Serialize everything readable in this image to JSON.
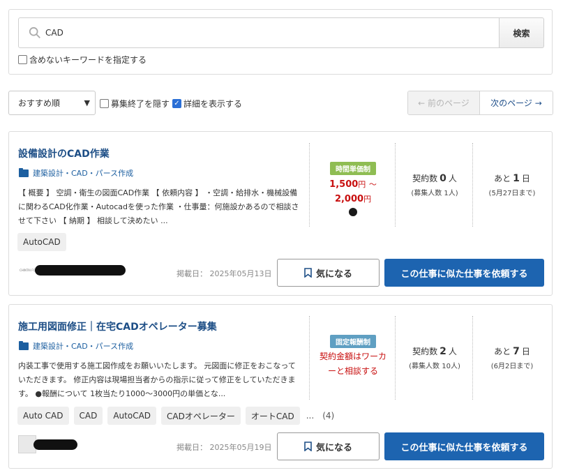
{
  "search": {
    "query": "CAD",
    "button_label": "検索",
    "exclude_label": "含めないキーワードを指定する"
  },
  "controls": {
    "sort_selected": "おすすめ順",
    "hide_closed_label": "募集終了を隠す",
    "show_details_label": "詳細を表示する",
    "prev_label": "← 前のページ",
    "next_label": "次のページ →"
  },
  "jobs": [
    {
      "title": "設備設計のCAD作業",
      "category": "建築設計・CAD・パース作成",
      "description": "【 概要 】 空調・衛生の図面CAD作業 【 依頼内容 】 ・空調・給排水・機械設備に関わるCAD化作業・Autocadを使った作業 ・仕事量：何施設かあるので相談させて下さい 【 納期 】 相談して決めたい ...",
      "price_type": "時間単価制",
      "price_from": "1,500",
      "price_to": "2,000",
      "yen": "円",
      "tilde": "～",
      "contracts_label": "契約数",
      "contracts_count": "0",
      "contracts_unit": "人",
      "recruit_note": "(募集人数 1人)",
      "remaining_label": "あと",
      "remaining_days": "1",
      "remaining_unit": "日",
      "deadline": "(5月27日まで)",
      "tags": [
        "AutoCAD"
      ],
      "posted": "掲載日： 2025年05月13日",
      "fav_label": "気になる",
      "request_label": "この仕事に似た仕事を依頼する",
      "client_logo_text": "CHINTAI FORM"
    },
    {
      "title": "施工用図面修正｜在宅CADオペレーター募集",
      "category": "建築設計・CAD・パース作成",
      "description": "内装工事で使用する施工図作成をお願いいたします。 元図面に修正をおこなっていただきます。 修正内容は現場担当者からの指示に従って修正をしていただきます。 ●報酬について 1枚当たり1000～3000円の単価とな...",
      "price_type": "固定報酬制",
      "price_note_line1": "契約金額はワーカ",
      "price_note_line2": "ーと相談する",
      "contracts_label": "契約数",
      "contracts_count": "2",
      "contracts_unit": "人",
      "recruit_note": "(募集人数 10人)",
      "remaining_label": "あと",
      "remaining_days": "7",
      "remaining_unit": "日",
      "deadline": "(6月2日まで)",
      "tags": [
        "Auto CAD",
        "CAD",
        "AutoCAD",
        "CADオペレーター",
        "オートCAD"
      ],
      "tags_more": "...",
      "tags_more_count": "(4)",
      "posted": "掲載日： 2025年05月19日",
      "fav_label": "気になる",
      "request_label": "この仕事に似た仕事を依頼する"
    }
  ],
  "colors": {
    "link_blue": "#1d4e86",
    "primary_button": "#1d64b0",
    "price_red": "#c80f0f",
    "hourly_badge": "#8fbd53",
    "fixed_badge": "#5f9fc2"
  }
}
